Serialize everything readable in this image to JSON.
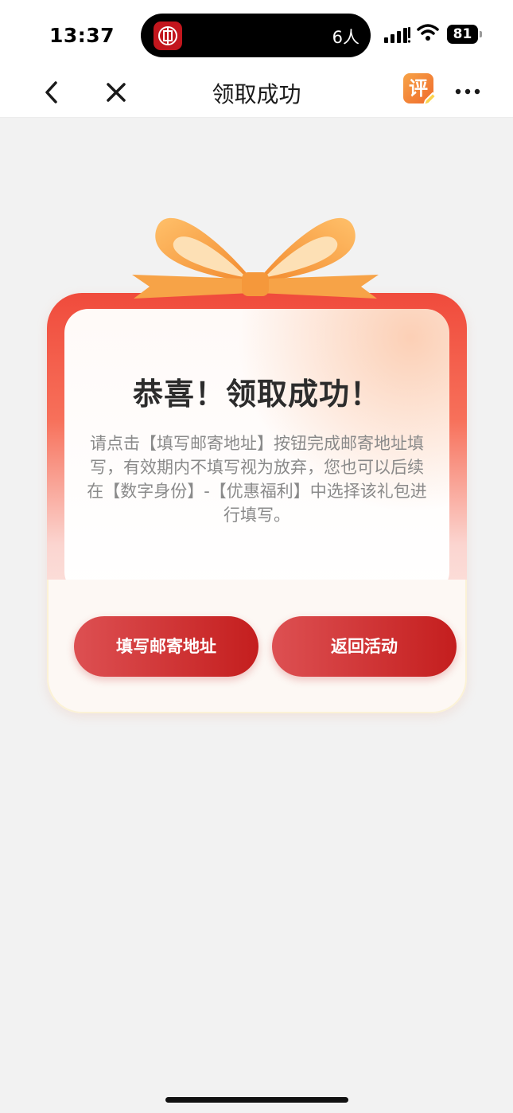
{
  "status_bar": {
    "time": "13:37",
    "island_count": "6人",
    "battery": "81"
  },
  "nav": {
    "title": "领取成功",
    "rate_icon_text": "评"
  },
  "card": {
    "title": "恭喜！领取成功！",
    "description": "请点击【填写邮寄地址】按钮完成邮寄地址填写，有效期内不填写视为放弃，您也可以后续在【数字身份】-【优惠福利】中选择该礼包进行填写。",
    "fill_address_label": "填写邮寄地址",
    "return_label": "返回活动"
  },
  "colors": {
    "accent_red": "#c41e1e",
    "ribbon_orange": "#f7a347"
  }
}
